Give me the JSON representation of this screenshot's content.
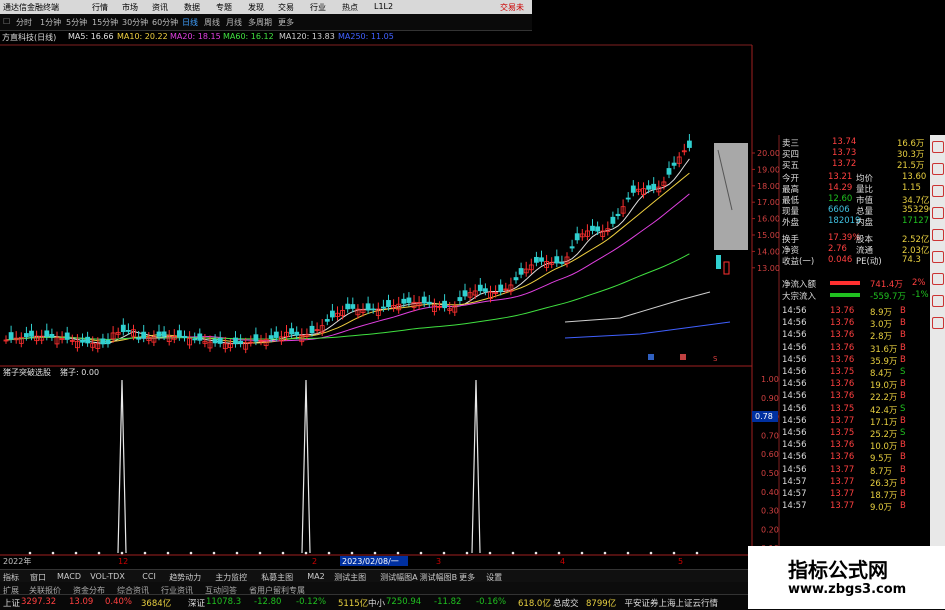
{
  "titlebar": {
    "app": "通达信金融终端",
    "menus": [
      "行情",
      "市场",
      "资讯",
      "数据",
      "专题",
      "发现",
      "交易",
      "行业",
      "热点",
      "L1L2"
    ],
    "right": "交易未"
  },
  "toolbar": {
    "items": [
      "分时",
      "1分钟",
      "5分钟",
      "15分钟",
      "30分钟",
      "60分钟",
      "日线",
      "周线",
      "月线",
      "多周期",
      "更多"
    ],
    "active": "日线"
  },
  "legend": {
    "stock": "方直科技(日线)",
    "ma": [
      {
        "t": "MA5: 16.66",
        "c": "#e0e0e0"
      },
      {
        "t": "MA10: 20.22",
        "c": "#f0d040"
      },
      {
        "t": "MA20: 18.15",
        "c": "#e040e0"
      },
      {
        "t": "MA60: 16.12",
        "c": "#40e040"
      },
      {
        "t": "MA120: 13.83",
        "c": "#d0d0d0"
      },
      {
        "t": "MA250: 11.05",
        "c": "#4060ff"
      }
    ]
  },
  "indicator": {
    "label": "猪子突破选股",
    "value": "猪子: 0.00"
  },
  "price_axis": [
    "20.00",
    "19.00",
    "18.00",
    "17.00",
    "16.00",
    "15.00",
    "14.00",
    "13.00"
  ],
  "ind_axis": [
    "1.00",
    "0.90",
    "0.80",
    "0.70",
    "0.60",
    "0.50",
    "0.40",
    "0.30",
    "0.20",
    "0.10"
  ],
  "ind_marker": "0.78",
  "date_axis": {
    "year": "2022年",
    "date": "2023/02/08/一",
    "ticks": [
      "12",
      "2",
      "3",
      "4",
      "5"
    ]
  },
  "markers": [
    "财",
    "除",
    "S"
  ],
  "quote": {
    "book": [
      [
        "卖三",
        "13.74",
        "16.6万"
      ],
      [
        "买四",
        "13.73",
        "30.3万"
      ],
      [
        "买五",
        "13.72",
        "21.5万"
      ]
    ],
    "stats": [
      [
        "今开",
        "13.21",
        "均价",
        "13.60"
      ],
      [
        "最高",
        "14.29",
        "量比",
        "1.15"
      ],
      [
        "最低",
        "12.60",
        "市值",
        "34.7亿"
      ],
      [
        "现量",
        "6606",
        "总量",
        "353290"
      ],
      [
        "外盘",
        "182019",
        "内盘",
        "171271"
      ],
      [
        "换手",
        "17.39%",
        "股本",
        "2.52亿"
      ],
      [
        "净资",
        "2.76",
        "流通",
        "2.03亿"
      ],
      [
        "收益(一)",
        "0.046",
        "PE(动)",
        "74.3"
      ]
    ],
    "flow": [
      [
        "净流入额",
        "741.4万",
        "2%"
      ],
      [
        "大宗流入",
        "-559.7万",
        "-1%"
      ]
    ],
    "ticks": [
      [
        "14:56",
        "13.76",
        "8.9万",
        "B"
      ],
      [
        "14:56",
        "13.76",
        "3.0万",
        "B"
      ],
      [
        "14:56",
        "13.76",
        "2.8万",
        "B"
      ],
      [
        "14:56",
        "13.76",
        "31.6万",
        "B"
      ],
      [
        "14:56",
        "13.76",
        "35.9万",
        "B"
      ],
      [
        "14:56",
        "13.75",
        "8.4万",
        "S"
      ],
      [
        "14:56",
        "13.76",
        "19.0万",
        "B"
      ],
      [
        "14:56",
        "13.76",
        "22.2万",
        "B"
      ],
      [
        "14:56",
        "13.75",
        "42.4万",
        "S"
      ],
      [
        "14:56",
        "13.77",
        "17.1万",
        "B"
      ],
      [
        "14:56",
        "13.75",
        "25.2万",
        "S"
      ],
      [
        "14:56",
        "13.76",
        "10.0万",
        "B"
      ],
      [
        "14:56",
        "13.76",
        "9.5万",
        "B"
      ],
      [
        "14:56",
        "13.77",
        "8.7万",
        "B"
      ],
      [
        "14:57",
        "13.77",
        "26.3万",
        "B"
      ],
      [
        "14:57",
        "13.77",
        "18.7万",
        "B"
      ],
      [
        "14:57",
        "13.77",
        "9.0万",
        "B"
      ]
    ]
  },
  "tabs": [
    "指标",
    "窗口",
    "MACD",
    "VOL-TDX",
    "CCI",
    "趋势动力",
    "主力监控",
    "私募主图",
    "MA2",
    "测试主图",
    "测试幅图A",
    "测试幅图B",
    "更多",
    "设置"
  ],
  "tabs2": [
    "扩展",
    "关联报价",
    "资金分布",
    "综合资讯",
    "行业资讯",
    "互动问答",
    "省用户留利专属"
  ],
  "status": [
    [
      "上证",
      "3297.32",
      "13.09",
      "0.40%",
      "3684亿"
    ],
    [
      "深证",
      "11078.3",
      "-12.80",
      "-0.12%",
      "5115亿"
    ],
    [
      "中小",
      "7250.94",
      "-11.82",
      "-0.16%",
      "618.0亿"
    ]
  ],
  "status_right": [
    "总成交",
    "8799亿",
    "平安证券上海上证云行情"
  ],
  "watermark": {
    "title": "指标公式网",
    "url": "www.zbgs3.com"
  },
  "chart_data": {
    "type": "candlestick+indicator",
    "ylim": [
      12,
      20.5
    ],
    "indicator_spikes_at": [
      "2022-12",
      "2023-02",
      "2023-03"
    ],
    "indicator_range": [
      0,
      1
    ]
  }
}
